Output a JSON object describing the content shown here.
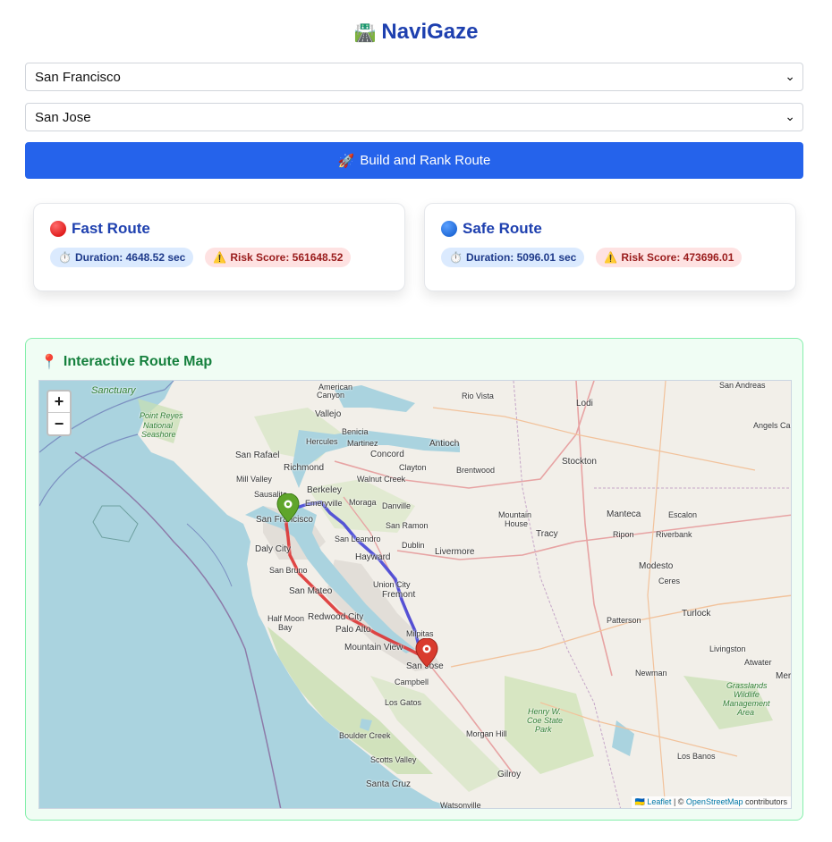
{
  "app": {
    "title_emoji": "🛣️",
    "title": "NaviGaze"
  },
  "form": {
    "origin_value": "San Francisco",
    "destination_value": "San Jose",
    "build_emoji": "🚀",
    "build_label": "Build and Rank Route"
  },
  "routes": [
    {
      "title": "Fast Route",
      "color": "#d32f2f",
      "duration_emoji": "⏱️",
      "duration_text": "Duration: 4648.52 sec",
      "risk_emoji": "⚠️",
      "risk_text": "Risk Score: 561648.52"
    },
    {
      "title": "Safe Route",
      "color": "#1565c0",
      "duration_emoji": "⏱️",
      "duration_text": "Duration: 5096.01 sec",
      "risk_emoji": "⚠️",
      "risk_text": "Risk Score: 473696.01"
    }
  ],
  "map": {
    "title_emoji": "📍",
    "title": "Interactive Route Map",
    "zoom_in": "+",
    "zoom_out": "−",
    "attribution": {
      "flag": "🇺🇦",
      "leaflet": "Leaflet",
      "sep1": " | © ",
      "osm": "OpenStreetMap",
      "tail": " contributors"
    },
    "places": {
      "sanctuary": "Sanctuary",
      "point_reyes_1": "Point Reyes",
      "point_reyes_2": "National",
      "point_reyes_3": "Seashore",
      "american_canyon_1": "American",
      "american_canyon_2": "Canyon",
      "vallejo": "Vallejo",
      "rio_vista": "Rio Vista",
      "lodi": "Lodi",
      "san_andreas": "San Andreas",
      "angels_camp": "Angels Cam",
      "benicia": "Benicia",
      "hercules": "Hercules",
      "martinez": "Martinez",
      "antioch": "Antioch",
      "san_rafael": "San Rafael",
      "concord": "Concord",
      "richmond": "Richmond",
      "clayton": "Clayton",
      "brentwood": "Brentwood",
      "stockton": "Stockton",
      "mill_valley": "Mill Valley",
      "walnut_creek": "Walnut Creek",
      "berkeley": "Berkeley",
      "sausalito": "Sausalito",
      "emeryville": "Emeryville",
      "moraga": "Moraga",
      "danville": "Danville",
      "manteca": "Manteca",
      "escalon": "Escalon",
      "mountain_house_1": "Mountain",
      "mountain_house_2": "House",
      "san_francisco": "San Francisco",
      "san_ramon": "San Ramon",
      "tracy": "Tracy",
      "ripon": "Ripon",
      "riverbank": "Riverbank",
      "san_leandro": "San Leandro",
      "dublin": "Dublin",
      "daly_city": "Daly City",
      "hayward": "Hayward",
      "livermore": "Livermore",
      "modesto": "Modesto",
      "san_bruno": "San Bruno",
      "ceres": "Ceres",
      "union_city": "Union City",
      "san_mateo": "San Mateo",
      "fremont": "Fremont",
      "turlock": "Turlock",
      "half_moon_bay_1": "Half Moon",
      "half_moon_bay_2": "Bay",
      "redwood_city": "Redwood City",
      "patterson": "Patterson",
      "milpitas": "Milpitas",
      "palo_alto": "Palo Alto",
      "livingston": "Livingston",
      "mountain_view": "Mountain View",
      "atwater": "Atwater",
      "mer": "Mer",
      "san_jose": "San Jose",
      "newman": "Newman",
      "campbell": "Campbell",
      "grasslands_1": "Grasslands",
      "grasslands_2": "Wildlife",
      "grasslands_3": "Management",
      "grasslands_4": "Area",
      "henry_coe_1": "Henry W.",
      "henry_coe_2": "Coe State",
      "henry_coe_3": "Park",
      "los_gatos": "Los Gatos",
      "boulder_creek": "Boulder Creek",
      "morgan_hill": "Morgan Hill",
      "los_banos": "Los Banos",
      "scotts_valley": "Scotts Valley",
      "gilroy": "Gilroy",
      "santa_cruz": "Santa Cruz",
      "watsonville": "Watsonville"
    }
  }
}
